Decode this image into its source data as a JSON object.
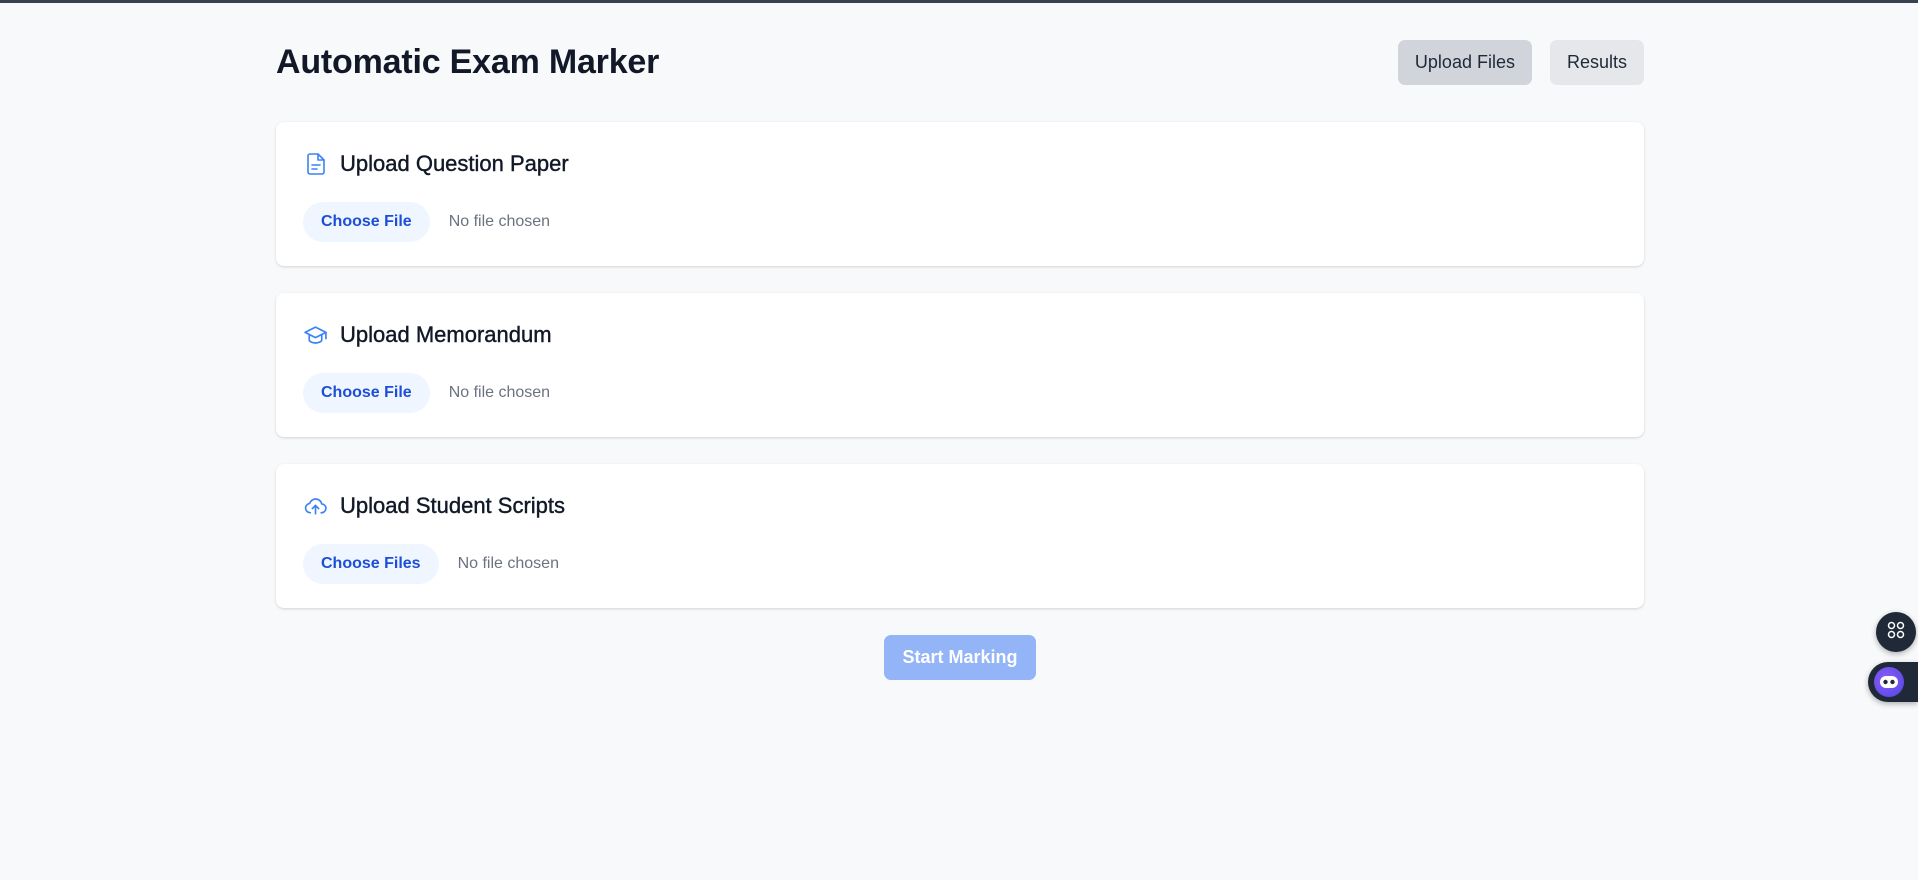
{
  "app": {
    "title": "Automatic Exam Marker"
  },
  "nav": {
    "upload_files_label": "Upload Files",
    "results_label": "Results",
    "active": "Upload Files"
  },
  "sections": [
    {
      "title": "Upload Question Paper",
      "icon": "document-icon",
      "button_label": "Choose File",
      "status": "No file chosen"
    },
    {
      "title": "Upload Memorandum",
      "icon": "graduation-cap-icon",
      "button_label": "Choose File",
      "status": "No file chosen"
    },
    {
      "title": "Upload Student Scripts",
      "icon": "cloud-upload-icon",
      "button_label": "Choose Files",
      "status": "No file chosen"
    }
  ],
  "actions": {
    "start_marking_label": "Start Marking",
    "start_marking_disabled": true
  },
  "floating": {
    "grid_icon": "grid-icon",
    "assistant_icon": "assistant-bot-icon"
  },
  "colors": {
    "accent": "#3b82f6",
    "accent_dark": "#1d4ed8",
    "accent_light": "#eff6ff",
    "disabled_button": "#93b4f7",
    "nav_active": "#d1d5db",
    "nav_inactive": "#e5e7eb",
    "page_background": "#f8f9fb"
  }
}
